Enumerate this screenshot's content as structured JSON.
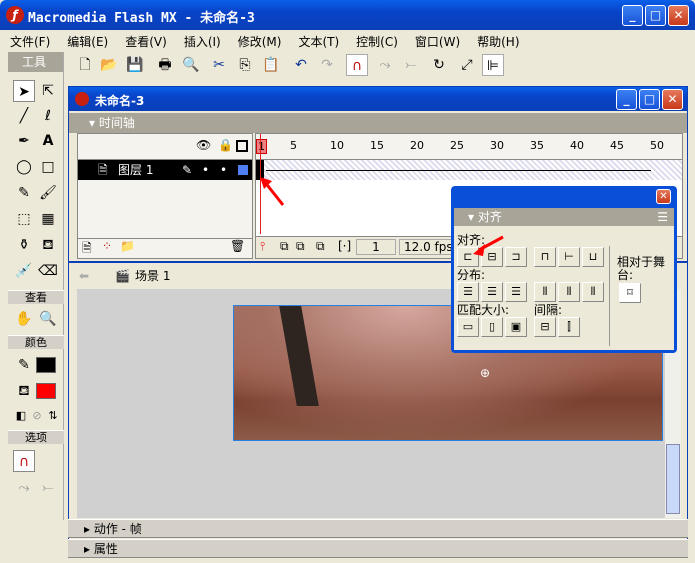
{
  "app": {
    "title": "Macromedia Flash MX - 未命名-3"
  },
  "menu": [
    "文件(F)",
    "编辑(E)",
    "查看(V)",
    "插入(I)",
    "修改(M)",
    "文本(T)",
    "控制(C)",
    "窗口(W)",
    "帮助(H)"
  ],
  "toolbox": {
    "title": "工具",
    "view_label": "查看",
    "colors_label": "颜色",
    "options_label": "选项",
    "stroke_color": "#000000",
    "fill_color": "#ff0000"
  },
  "document": {
    "title": "未命名-3",
    "timeline_label": "时间轴",
    "layer_name": "图层 1",
    "frame_ticks": [
      "1",
      "5",
      "10",
      "15",
      "20",
      "25",
      "30",
      "35",
      "40",
      "45",
      "50"
    ],
    "current_frame": "1",
    "fps": "12.0 fps",
    "scene": "场景 1"
  },
  "align_panel": {
    "title": "对齐",
    "align_label": "对齐:",
    "distribute_label": "分布:",
    "match_size_label": "匹配大小:",
    "space_label": "间隔:",
    "relative_label": "相对于舞台:"
  },
  "bottom_panels": {
    "actions": "动作 - 帧",
    "properties": "属性"
  }
}
